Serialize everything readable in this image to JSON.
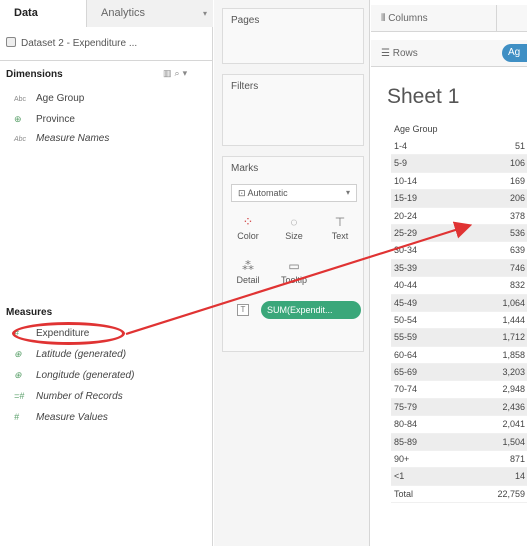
{
  "tabs": {
    "data": "Data",
    "analytics": "Analytics"
  },
  "datasource": "Dataset 2 - Expenditure ...",
  "dimensions": {
    "title": "Dimensions",
    "items": [
      {
        "label": "Age Group",
        "icon": "Abc"
      },
      {
        "label": "Province",
        "icon": "globe"
      },
      {
        "label": "Measure Names",
        "icon": "Abc"
      }
    ]
  },
  "measures": {
    "title": "Measures",
    "items": [
      {
        "label": "Expenditure",
        "icon": "#"
      },
      {
        "label": "Latitude (generated)",
        "icon": "globe"
      },
      {
        "label": "Longitude (generated)",
        "icon": "globe"
      },
      {
        "label": "Number of Records",
        "icon": "=#"
      },
      {
        "label": "Measure Values",
        "icon": "#"
      }
    ]
  },
  "cards": {
    "pages": "Pages",
    "filters": "Filters",
    "marks": "Marks",
    "marks_type": "Automatic",
    "buttons": {
      "color": "Color",
      "size": "Size",
      "text": "Text",
      "detail": "Detail",
      "tooltip": "Tooltip"
    },
    "pill": "SUM(Expendit..."
  },
  "shelves": {
    "columns": "Columns",
    "rows": "Rows",
    "rows_pill": "Ag"
  },
  "sheet": {
    "title": "Sheet 1",
    "column_header": "Age Group",
    "rows": [
      {
        "cat": "1-4",
        "val": "51"
      },
      {
        "cat": "5-9",
        "val": "106"
      },
      {
        "cat": "10-14",
        "val": "169"
      },
      {
        "cat": "15-19",
        "val": "206"
      },
      {
        "cat": "20-24",
        "val": "378"
      },
      {
        "cat": "25-29",
        "val": "536"
      },
      {
        "cat": "30-34",
        "val": "639"
      },
      {
        "cat": "35-39",
        "val": "746"
      },
      {
        "cat": "40-44",
        "val": "832"
      },
      {
        "cat": "45-49",
        "val": "1,064"
      },
      {
        "cat": "50-54",
        "val": "1,444"
      },
      {
        "cat": "55-59",
        "val": "1,712"
      },
      {
        "cat": "60-64",
        "val": "1,858"
      },
      {
        "cat": "65-69",
        "val": "3,203"
      },
      {
        "cat": "70-74",
        "val": "2,948"
      },
      {
        "cat": "75-79",
        "val": "2,436"
      },
      {
        "cat": "80-84",
        "val": "2,041"
      },
      {
        "cat": "85-89",
        "val": "1,504"
      },
      {
        "cat": "90+",
        "val": "871"
      },
      {
        "cat": "<1",
        "val": "14"
      },
      {
        "cat": "Total",
        "val": "22,759"
      }
    ]
  },
  "colors": {
    "annotation": "#e03333",
    "measure_pill": "#3aa77a",
    "dimension_pill": "#3f8fc4"
  }
}
